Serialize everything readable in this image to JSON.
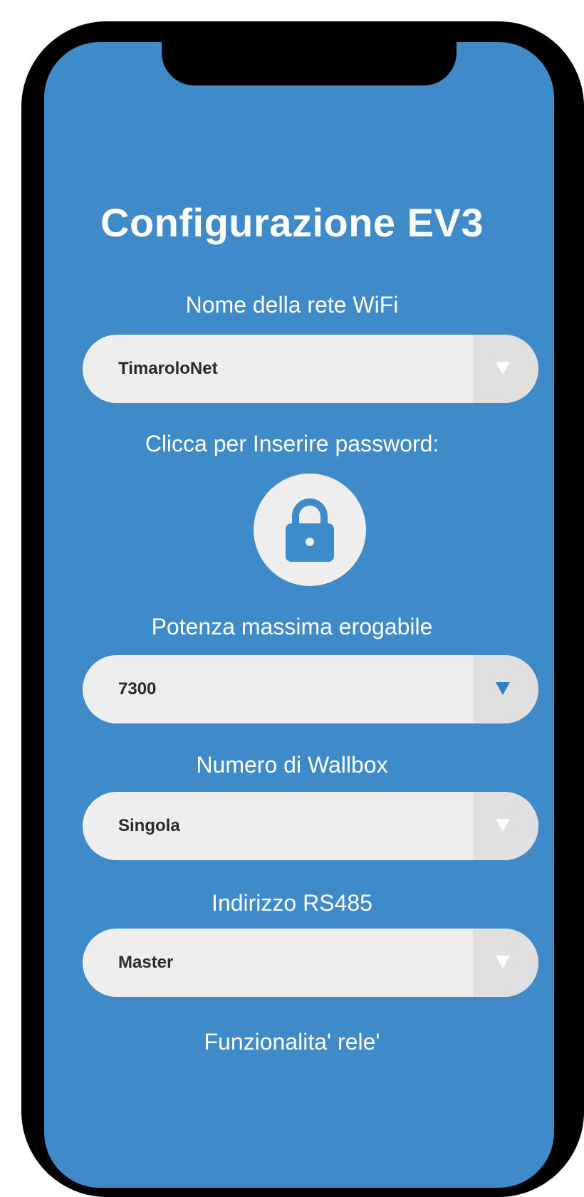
{
  "app": {
    "title": "Configurazione EV3"
  },
  "wifi": {
    "label": "Nome della rete WiFi",
    "value": "TimaroloNet"
  },
  "password": {
    "label": "Clicca per Inserire password:",
    "icon": "lock-icon"
  },
  "power": {
    "label": "Potenza massima erogabile",
    "value": "7300"
  },
  "wallbox": {
    "label": "Numero di Wallbox",
    "value": "Singola"
  },
  "rs485": {
    "label": "Indirizzo RS485",
    "value": "Master"
  },
  "relay": {
    "label": "Funzionalita' rele'"
  },
  "colors": {
    "background": "#3f8ac8",
    "frame": "#000000",
    "field": "#eeeeee",
    "accent_arrow": "#2f7fc4"
  }
}
